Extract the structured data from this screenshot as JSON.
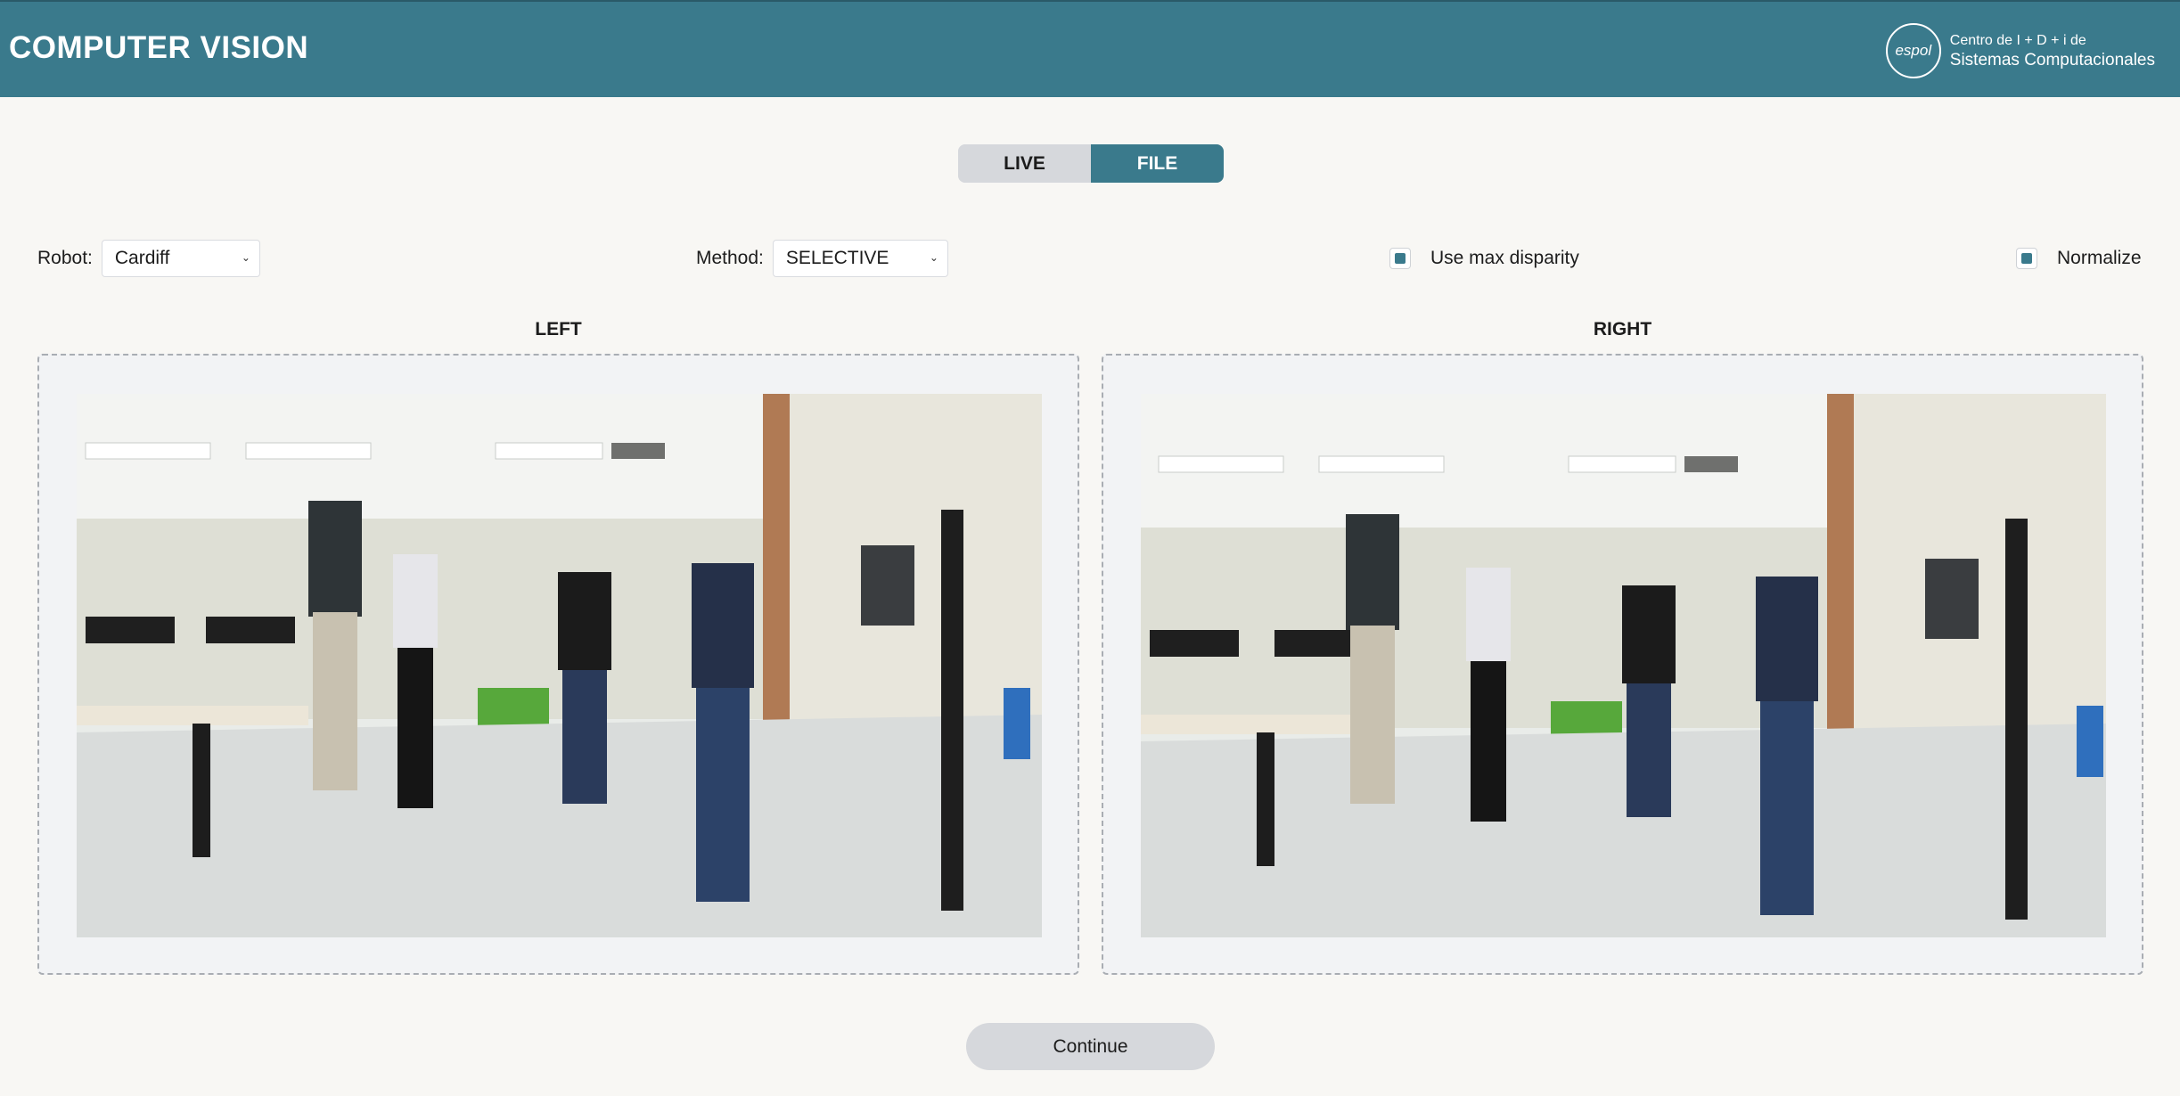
{
  "header": {
    "title": "COMPUTER VISION",
    "brand_logo": "espol",
    "brand_line1": "Centro de I + D + i de",
    "brand_line2": "Sistemas Computacionales"
  },
  "mode_toggle": {
    "live_label": "LIVE",
    "file_label": "FILE",
    "active": "FILE"
  },
  "controls": {
    "robot_label": "Robot:",
    "robot_value": "Cardiff",
    "method_label": "Method:",
    "method_value": "SELECTIVE",
    "max_disparity_label": "Use max disparity",
    "max_disparity_checked": true,
    "normalize_label": "Normalize",
    "normalize_checked": true
  },
  "panels": {
    "left_label": "LEFT",
    "right_label": "RIGHT"
  },
  "continue_label": "Continue",
  "colors": {
    "accent": "#3a7a8c",
    "background": "#f8f7f4",
    "button_gray": "#d6d8dc"
  }
}
